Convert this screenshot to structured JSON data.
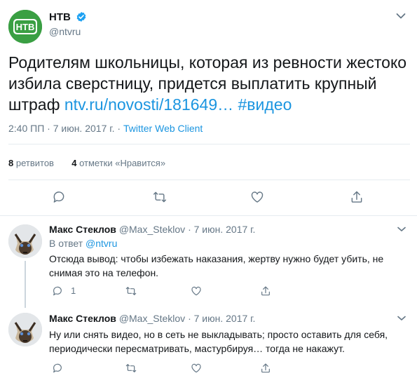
{
  "tweet": {
    "author_name": "НТВ",
    "author_handle": "@ntvru",
    "avatar_label": "НТВ",
    "text": "Родителям школьницы, которая из ревности жестоко избила сверстницу, придется выплатить крупный штраф ",
    "link": "ntv.ru/novosti/181649…",
    "hashtag": "#видео",
    "time": "2:40 ПП · 7 июн. 2017 г. · ",
    "client": "Twitter Web Client",
    "retweets_count": "8",
    "retweets_label": "ретвитов",
    "likes_count": "4",
    "likes_label": "отметки «Нравится»"
  },
  "replies": [
    {
      "name": "Макс Стеклов",
      "handle": "@Max_Steklov",
      "date": "· 7 июн. 2017 г.",
      "reply_to_prefix": "В ответ ",
      "reply_to_mention": "@ntvru",
      "text": "Отсюда вывод: чтобы избежать наказания, жертву нужно будет убить, не снимая это на телефон.",
      "reply_count": "1"
    },
    {
      "name": "Макс Стеклов",
      "handle": "@Max_Steklov",
      "date": "· 7 июн. 2017 г.",
      "text": "Ну или снять видео, но в сеть не выкладывать; просто оставить для себя, периодически пересматривать, мастурбируя… тогда не накажут."
    }
  ],
  "icons": {
    "reply": "reply-icon",
    "retweet": "retweet-icon",
    "like": "heart-icon",
    "share": "share-icon",
    "more": "chevron-down-icon",
    "verified": "verified-badge-icon"
  },
  "colors": {
    "link": "#1b95e0",
    "secondary_text": "#657786",
    "brand_green": "#3a9f43",
    "divider": "#e6ecf0"
  }
}
